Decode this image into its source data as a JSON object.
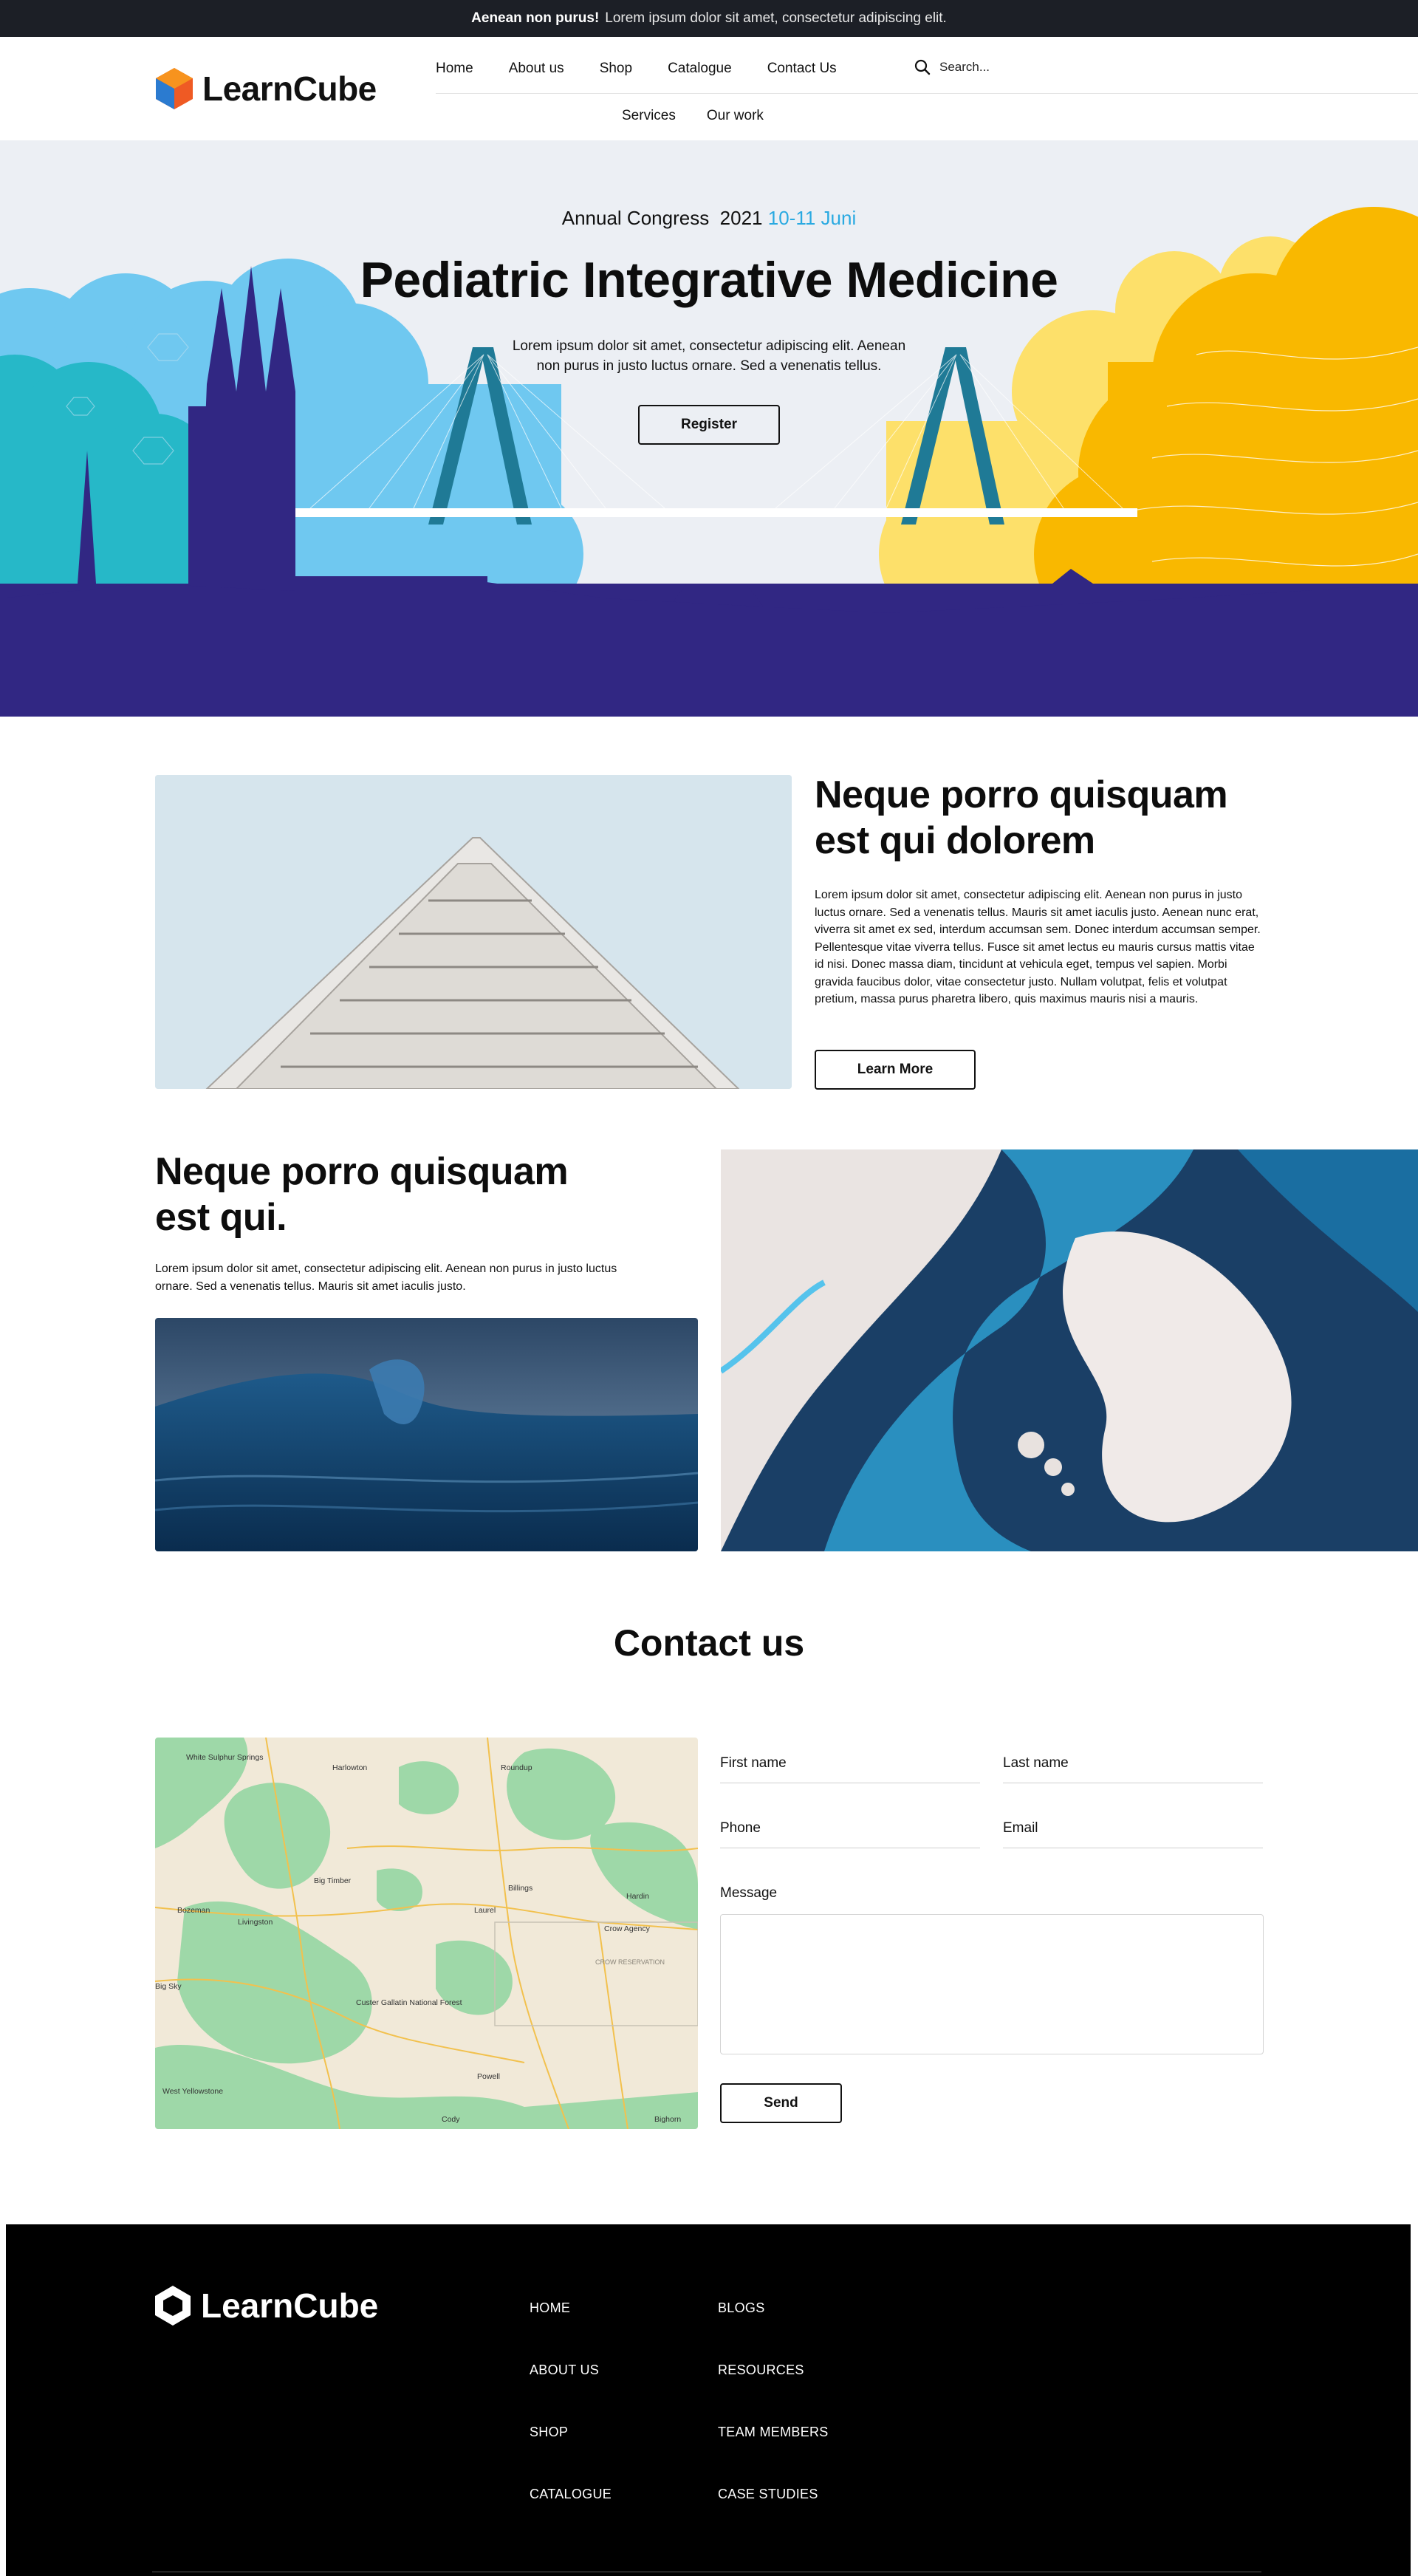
{
  "topbar": {
    "bold": "Aenean non purus!",
    "text": "Lorem ipsum dolor sit amet, consectetur adipiscing elit."
  },
  "header": {
    "logo": "LearnCube",
    "nav_row1": [
      "Home",
      "About us",
      "Shop",
      "Catalogue",
      "Contact Us"
    ],
    "nav_row2": [
      "Services",
      "Our work"
    ],
    "search_placeholder": "Search..."
  },
  "hero": {
    "event": "Annual Congress",
    "year": "2021",
    "dates": "10-11 Juni",
    "title": "Pediatric Integrative Medicine",
    "text": "Lorem ipsum dolor sit amet, consectetur adipiscing elit. Aenean non purus in justo luctus ornare. Sed a venenatis tellus.",
    "button": "Register"
  },
  "section1": {
    "title": "Neque porro quisquam est qui dolorem",
    "text": "Lorem ipsum dolor sit amet, consectetur adipiscing elit. Aenean non purus in justo luctus ornare. Sed a venenatis tellus. Mauris sit amet iaculis justo. Aenean nunc erat, viverra sit amet ex sed, interdum accumsan sem. Donec interdum accumsan semper. Pellentesque vitae viverra tellus. Fusce sit amet lectus eu mauris cursus mattis vitae id nisi. Donec massa diam, tincidunt at vehicula eget, tempus vel sapien. Morbi gravida faucibus dolor, vitae consectetur justo. Nullam volutpat, felis et volutpat pretium, massa purus pharetra libero, quis maximus mauris nisi a mauris.",
    "button": "Learn More"
  },
  "section2": {
    "title": "Neque porro quisquam est qui.",
    "text": "Lorem ipsum dolor sit amet, consectetur adipiscing elit. Aenean non purus in justo luctus ornare. Sed a venenatis tellus. Mauris sit amet iaculis justo."
  },
  "contact": {
    "title": "Contact us",
    "first_name": "First name",
    "last_name": "Last name",
    "phone": "Phone",
    "email": "Email",
    "message": "Message",
    "send": "Send",
    "map_labels": [
      "White Sulphur Springs",
      "Harlowton",
      "Roundup",
      "Big Timber",
      "Billings",
      "Hardin",
      "Bozeman",
      "Livingston",
      "Laurel",
      "Crow Agency",
      "CROW RESERVATION",
      "Custer Gallatin National Forest",
      "Big Sky",
      "Powell",
      "West Yellowstone",
      "Cody",
      "Bighorn"
    ]
  },
  "footer": {
    "logo": "LearnCube",
    "col1": [
      "HOME",
      "ABOUT US",
      "SHOP",
      "CATALOGUE"
    ],
    "col2": [
      "BLOGS",
      "RESOURCES",
      "TEAM MEMBERS",
      "CASE STUDIES"
    ]
  },
  "colors": {
    "topbar": "#1c1f26",
    "accent": "#29a9e1",
    "purple": "#312783",
    "yellow": "#f9b800",
    "footer": "#000000"
  }
}
